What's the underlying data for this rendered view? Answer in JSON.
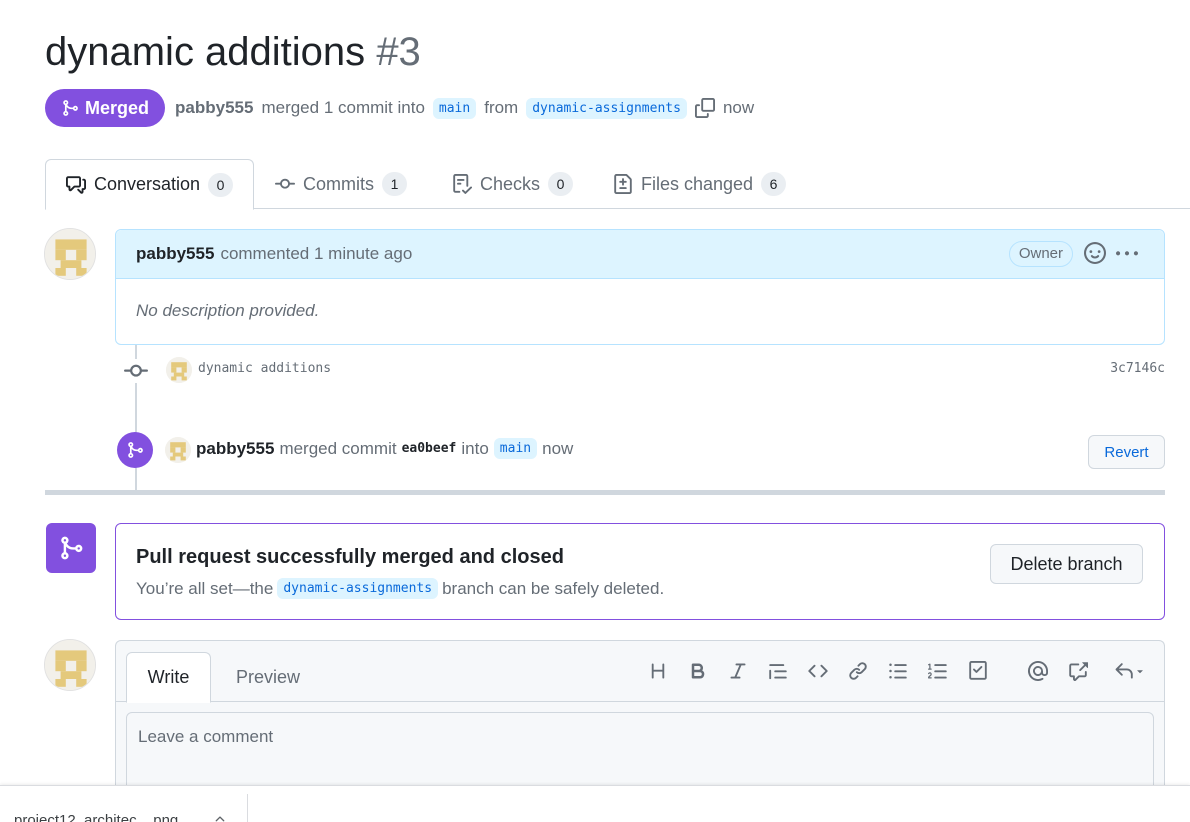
{
  "pr": {
    "title": "dynamic additions",
    "number": "#3",
    "state": "Merged",
    "author": "pabby555",
    "action": "merged 1 commit into",
    "base_branch": "main",
    "from": "from",
    "head_branch": "dynamic-assignments",
    "time": "now"
  },
  "tabs": [
    {
      "label": "Conversation",
      "count": "0",
      "icon": "comment-discussion-icon"
    },
    {
      "label": "Commits",
      "count": "1",
      "icon": "git-commit-icon"
    },
    {
      "label": "Checks",
      "count": "0",
      "icon": "checklist-icon"
    },
    {
      "label": "Files changed",
      "count": "6",
      "icon": "file-diff-icon"
    }
  ],
  "comment": {
    "author": "pabby555",
    "meta": "commented 1 minute ago",
    "badge": "Owner",
    "body": "No description provided."
  },
  "commit": {
    "message": "dynamic additions",
    "sha": "3c7146c"
  },
  "merge_event": {
    "author": "pabby555",
    "text1": "merged commit",
    "sha": "ea0beef",
    "text2": "into",
    "branch": "main",
    "time": "now",
    "revert_label": "Revert"
  },
  "merge_box": {
    "title": "Pull request successfully merged and closed",
    "sub1": "You’re all set—the",
    "branch": "dynamic-assignments",
    "sub2": "branch can be safely deleted.",
    "delete_label": "Delete branch"
  },
  "editor": {
    "write_tab": "Write",
    "preview_tab": "Preview",
    "placeholder": "Leave a comment",
    "toolbar": [
      "heading-icon",
      "bold-icon",
      "italic-icon",
      "quote-icon",
      "code-icon",
      "link-icon",
      "unordered-list-icon",
      "ordered-list-icon",
      "task-list-icon",
      "mention-icon",
      "cross-reference-icon",
      "reply-icon"
    ]
  },
  "download": {
    "filename": "project12_architec....png"
  },
  "colors": {
    "merged_purple": "#8250df",
    "link_blue": "#0969da",
    "branch_bg": "#ddf4ff"
  }
}
